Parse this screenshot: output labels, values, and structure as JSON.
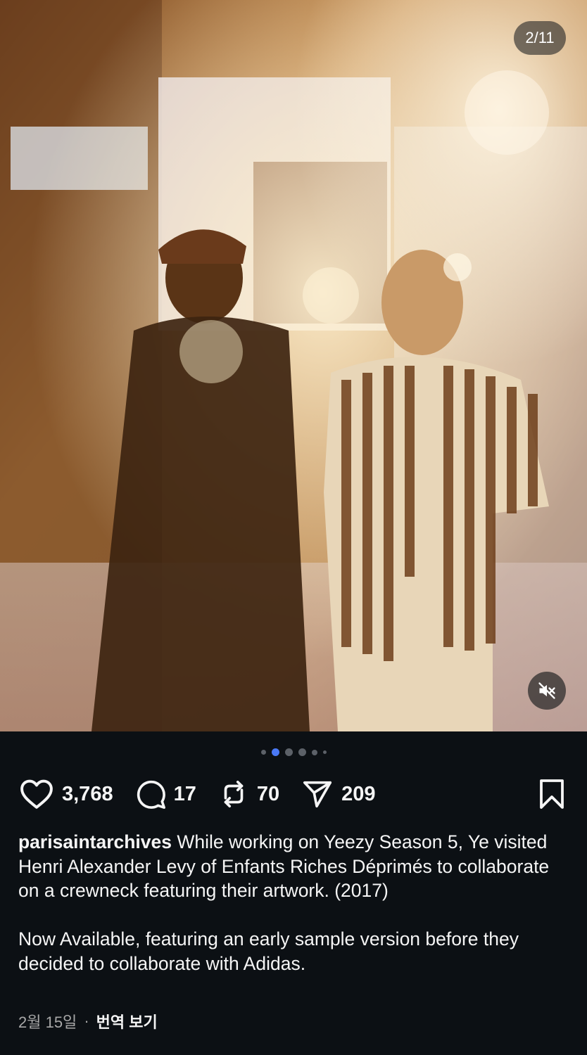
{
  "post": {
    "media": {
      "counter": "2/11",
      "current_index": 2,
      "total": 11,
      "muted": true,
      "description_icon": "photo-collage-image"
    },
    "carousel": {
      "dot_count": 6,
      "active_dot": 2
    },
    "actions": {
      "likes": "3,768",
      "comments": "17",
      "reposts": "70",
      "shares": "209"
    },
    "caption": {
      "username": "parisaintarchives",
      "paragraph1": "While working on Yeezy Season 5, Ye visited Henri Alexander Levy of Enfants Riches Déprimés to collaborate on a crewneck featuring their artwork. (2017)",
      "paragraph2": "Now Available, featuring an early sample version before they decided to collaborate with Adidas."
    },
    "meta": {
      "date": "2월 15일",
      "separator": "·",
      "translate_label": "번역 보기"
    },
    "colors": {
      "background": "#0c1014",
      "text": "#f5f5f5",
      "muted_text": "#a8a8a8",
      "active_dot": "#4a79f5"
    }
  }
}
